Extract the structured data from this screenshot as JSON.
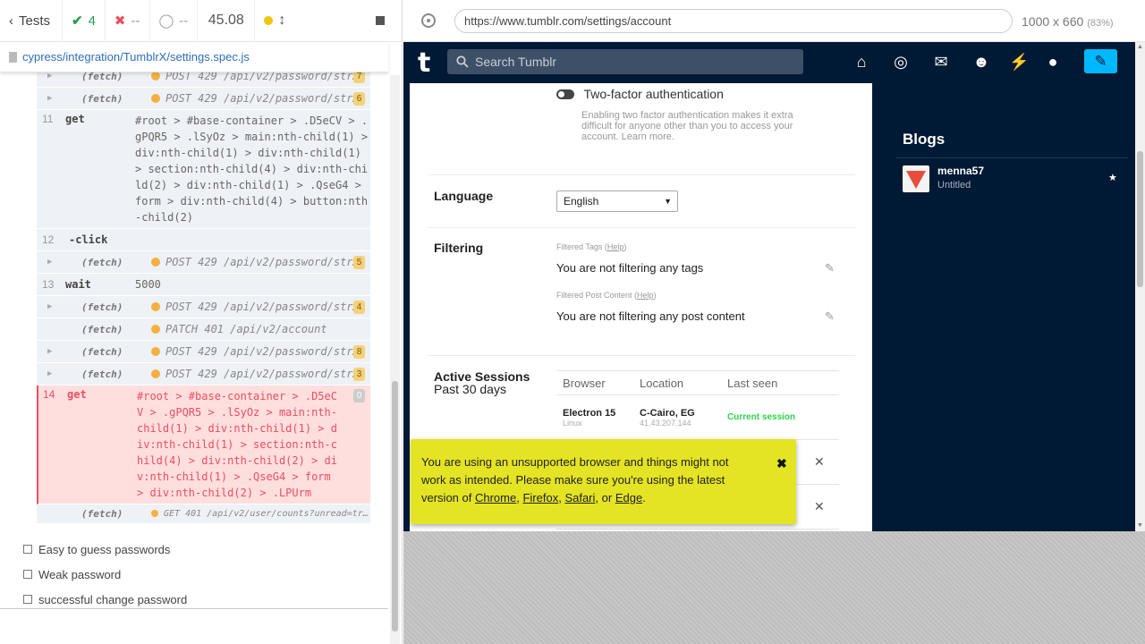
{
  "reporter": {
    "tests_label": "Tests",
    "passed": "4",
    "failed": "--",
    "pending": "--",
    "duration": "45.08",
    "spec_path": "cypress/integration/TumblrX/settings.spec.js"
  },
  "log": {
    "fetch": "(fetch)",
    "rows": [
      {
        "type": "fetch",
        "msg": "POST 429 /api/v2/password/str…",
        "badge": "7"
      },
      {
        "type": "fetch",
        "msg": "POST 429 /api/v2/password/str…",
        "badge": "6"
      },
      {
        "type": "get",
        "num": "11",
        "name": "get",
        "msg": "#root > #base-container > .D5eCV > .gPQR5 > .lSyOz > main:nth-child(1) > div:nth-child(1) > div:nth-child(1) > section:nth-child(4) > div:nth-child(2) > div:nth-child(1) > .QseG4 > form > div:nth-child(4) > button:nth-child(2)"
      },
      {
        "type": "click",
        "num": "12",
        "name": "-click"
      },
      {
        "type": "fetch",
        "msg": "POST 429 /api/v2/password/str…",
        "badge": "5"
      },
      {
        "type": "wait",
        "num": "13",
        "name": "wait",
        "msg": "5000"
      },
      {
        "type": "fetch",
        "msg": "POST 429 /api/v2/password/str…",
        "badge": "4"
      },
      {
        "type": "fetch-nocaret",
        "msg": "PATCH 401 /api/v2/account"
      },
      {
        "type": "fetch",
        "msg": "POST 429 /api/v2/password/str…",
        "badge": "8"
      },
      {
        "type": "fetch",
        "msg": "POST 429 /api/v2/password/str…",
        "badge": "3"
      },
      {
        "type": "fail",
        "num": "14",
        "name": "get",
        "msg": "#root > #base-container > .D5eCV > .gPQR5 > .lSyOz > main:nth-child(1) > div:nth-child(1) > div:nth-child(1) > section:nth-child(4) > div:nth-child(2) > div:nth-child(1) > .QseG4 > form > div:nth-child(2) > .LPUrm",
        "badge": "0"
      },
      {
        "type": "fetch-small",
        "msg": "GET 401 /api/v2/user/counts?unread=tr…"
      }
    ]
  },
  "tests": [
    "Easy to guess passwords",
    "Weak password",
    "successful change password"
  ],
  "aut": {
    "url": "https://www.tumblr.com/settings/account",
    "viewport": "1000 x 660",
    "scale": "(83%)"
  },
  "tumblr": {
    "search_placeholder": "Search Tumblr",
    "two_factor_title": "Two-factor authentication",
    "two_factor_desc": "Enabling two factor authentication makes it extra difficult for anyone other than you to access your account. Learn more.",
    "language_label": "Language",
    "language_value": "English",
    "filtering_label": "Filtering",
    "filtered_tags_label": "Filtered Tags (",
    "filtered_tags_help": "Help",
    "filtered_tags_text": "You are not filtering any tags",
    "filtered_content_label": "Filtered Post Content (",
    "filtered_content_help": "Help",
    "filtered_content_text": "You are not filtering any post content",
    "sessions_label": "Active Sessions",
    "sessions_sub": "Past 30 days",
    "table_headers": [
      "Browser",
      "Location",
      "Last seen"
    ],
    "session": {
      "browser": "Electron 15",
      "os": "Linux",
      "location": "C-Cairo, EG",
      "ip": "41.43.207.144",
      "seen": "Current session"
    },
    "blogs_title": "Blogs",
    "blog_name": "menna57",
    "blog_sub": "Untitled",
    "banner_text_1": "You are using an unsupported browser and things might not work as intended. Please make sure you're using the latest version of ",
    "banner_links": [
      "Chrome",
      "Firefox",
      "Safari",
      "Edge"
    ],
    "banner_sep_1": ", ",
    "banner_sep_2": ", ",
    "banner_sep_3": ", or ",
    "banner_end": "."
  }
}
